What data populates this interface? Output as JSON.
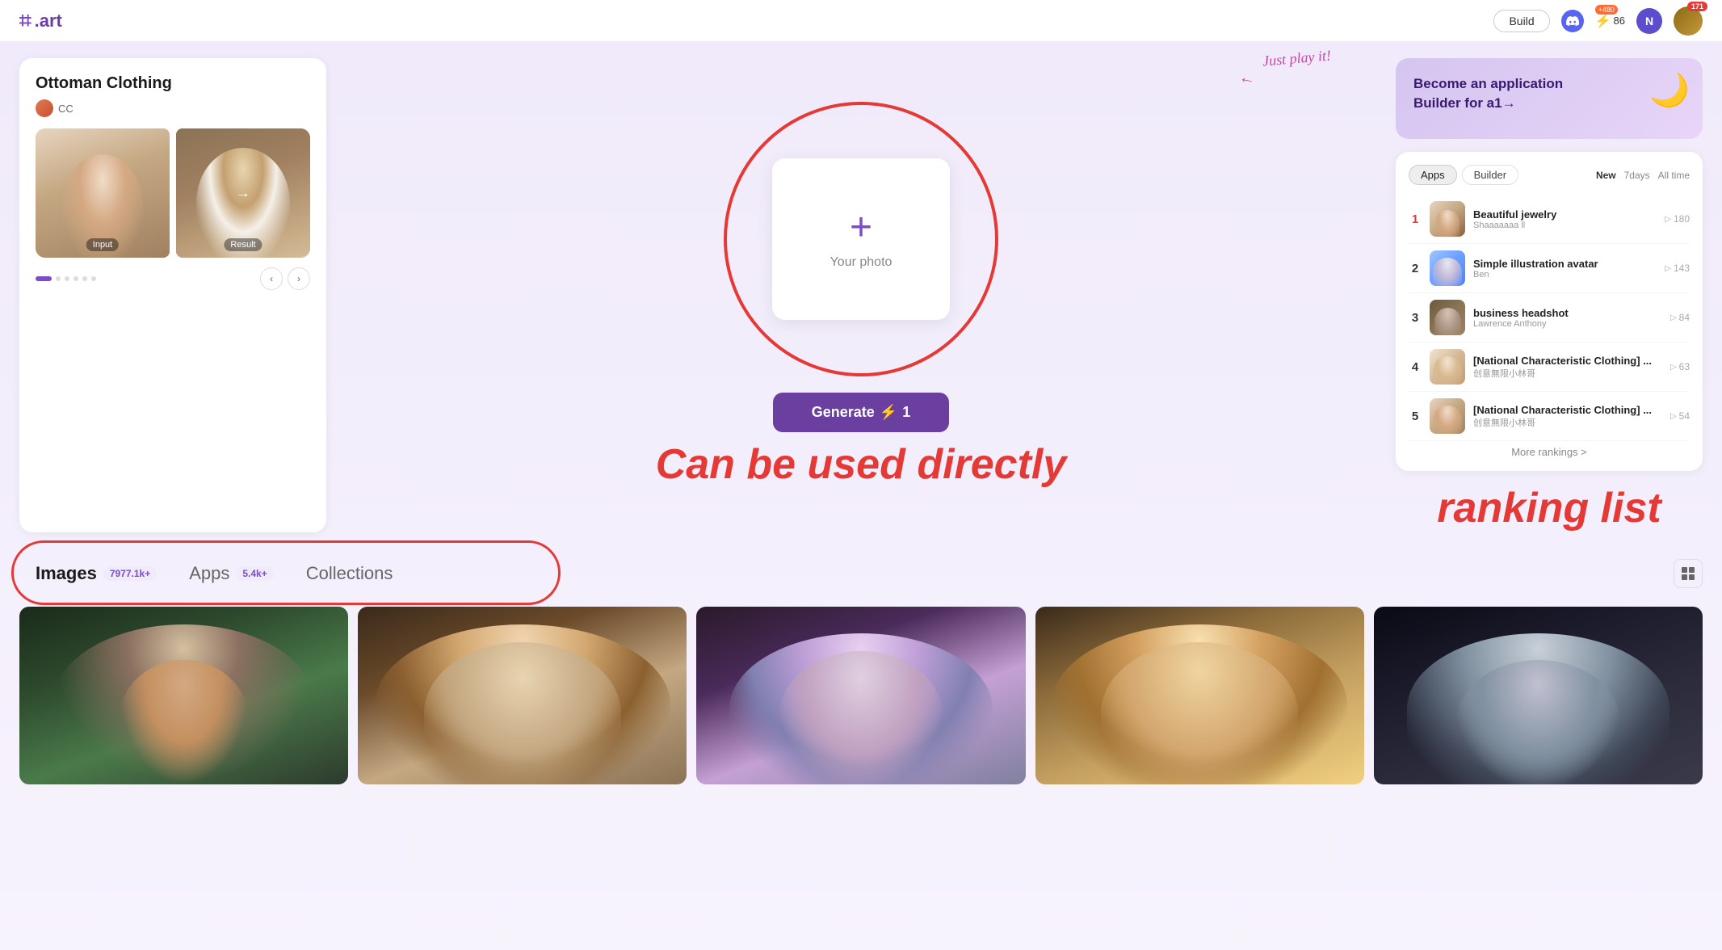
{
  "header": {
    "logo_text": ".art",
    "build_label": "Build",
    "lightning_plus": "+480",
    "lightning_count": "86",
    "avatar_letter": "N",
    "user_badge": "171"
  },
  "left_card": {
    "title": "Ottoman Clothing",
    "user": "CC",
    "input_label": "Input",
    "result_label": "Result"
  },
  "center": {
    "annotation": "Just play it!",
    "upload_text": "Your photo",
    "generate_label": "Generate",
    "generate_cost": "⚡1",
    "used_directly_text": "Can be used directly"
  },
  "right_panel": {
    "become_builder_text": "Become an application Builder for a1→",
    "tabs": [
      "Apps",
      "Builder"
    ],
    "active_tab": "Apps",
    "time_filters": [
      "New",
      "7days",
      "All time"
    ],
    "active_filter": "New",
    "ranking_items": [
      {
        "rank": "1",
        "name": "Beautiful jewelry",
        "author": "Shaaaaaaa ll",
        "count": "180",
        "thumb_class": "ranking-thumb-1"
      },
      {
        "rank": "2",
        "name": "Simple illustration avatar",
        "author": "Ben",
        "count": "143",
        "thumb_class": "ranking-thumb-2"
      },
      {
        "rank": "3",
        "name": "business headshot",
        "author": "Lawrence Anthony",
        "count": "84",
        "thumb_class": "ranking-thumb-3"
      },
      {
        "rank": "4",
        "name": "[National Characteristic Clothing] ...",
        "author": "创意無限小林哥",
        "count": "63",
        "thumb_class": "ranking-thumb-4"
      },
      {
        "rank": "5",
        "name": "[National Characteristic Clothing] ...",
        "author": "创意無限小林哥",
        "count": "54",
        "thumb_class": "ranking-thumb-5"
      }
    ],
    "more_label": "More rankings >",
    "ranking_annotation": "ranking list"
  },
  "bottom_tabs": {
    "images_label": "Images",
    "images_count": "7977.1k+",
    "apps_label": "Apps",
    "apps_count": "5.4k+",
    "collections_label": "Collections"
  },
  "annotations": {
    "just_play_it": "Just play it!",
    "can_be_used_directly": "Can be used directly",
    "ranking_list": "ranking list"
  }
}
